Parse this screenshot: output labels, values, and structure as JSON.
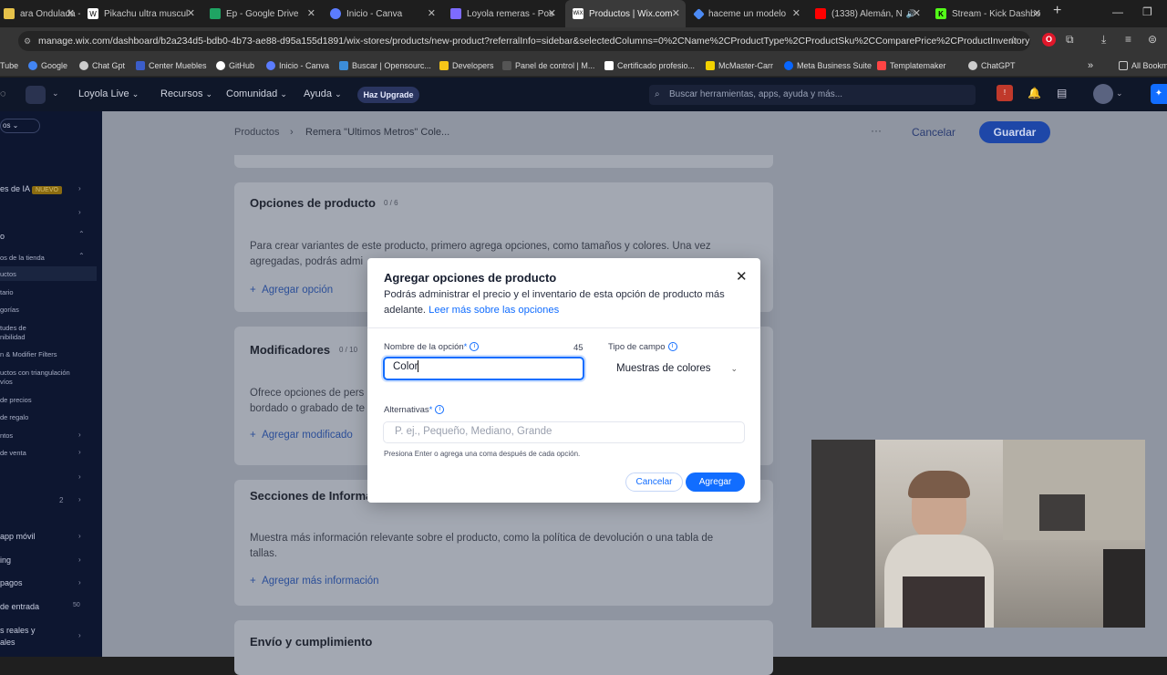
{
  "browser": {
    "tabs": [
      {
        "label": "ara Ondulada -",
        "color": "#e6c24a"
      },
      {
        "label": "Pikachu ultra muscul",
        "color": "#000000",
        "glyph": "W"
      },
      {
        "label": "Ep - Google Drive",
        "color": "#1fa463"
      },
      {
        "label": "Inicio - Canva",
        "color": "#5b7cff"
      },
      {
        "label": "Loyola remeras - Pos",
        "color": "#7d6bff"
      },
      {
        "label": "Productos | Wix.com",
        "color": "#000000",
        "glyph": "WiX"
      },
      {
        "label": "haceme un modelo",
        "color": "#4c8bf5"
      },
      {
        "label": "(1338) Alemán, N",
        "color": "#ff0000"
      },
      {
        "label": "Stream - Kick Dashbo",
        "color": "#53fc18"
      }
    ],
    "url": "manage.wix.com/dashboard/b2a234d5-bdb0-4b73-ae88-d95a155d1891/wix-stores/products/new-product?referralInfo=sidebar&selectedColumns=0%2CName%2CProductType%2CProductSku%2CComparePrice%2CProductInventorySta...",
    "bookmarks": [
      {
        "label": "Tube",
        "color": "#ff0000"
      },
      {
        "label": "Google",
        "color": "#4285f4"
      },
      {
        "label": "Chat Gpt",
        "color": "#cccccc"
      },
      {
        "label": "Center Muebles",
        "color": "#3b5dc9"
      },
      {
        "label": "GitHub",
        "color": "#ffffff"
      },
      {
        "label": "Inicio - Canva",
        "color": "#5b7cff"
      },
      {
        "label": "Buscar | Opensourc...",
        "color": "#3c8dd9"
      },
      {
        "label": "Developers",
        "color": "#f5c518"
      },
      {
        "label": "Panel de control | M...",
        "color": "#555555"
      },
      {
        "label": "Certificado profesio...",
        "color": "#ffffff"
      },
      {
        "label": "McMaster-Carr",
        "color": "#f2d100"
      },
      {
        "label": "Meta Business Suite",
        "color": "#0866ff"
      },
      {
        "label": "Templatemaker",
        "color": "#ff4444"
      },
      {
        "label": "ChatGPT",
        "color": "#cccccc"
      }
    ],
    "all_bookmarks": "All Bookm"
  },
  "wix_nav": {
    "site_name": "Loyola Live",
    "resources": "Recursos",
    "community": "Comunidad",
    "help": "Ayuda",
    "upgrade": "Haz Upgrade",
    "search_placeholder": "Buscar herramientas, apps, ayuda y más..."
  },
  "sidebar": {
    "top_label": "os",
    "items": [
      {
        "label": "es de IA",
        "badge": "NUEVO"
      },
      {
        "label": "o"
      },
      {
        "label": "os de la tienda"
      },
      {
        "label": "uctos"
      },
      {
        "label": "tario"
      },
      {
        "label": "gorías"
      },
      {
        "label": "tudes de"
      },
      {
        "label": "nibilidad"
      },
      {
        "label": "n & Modifier Filters"
      },
      {
        "label": "uctos con triangulación"
      },
      {
        "label": "víos"
      },
      {
        "label": "de precios"
      },
      {
        "label": "de regalo"
      },
      {
        "label": "ntos"
      },
      {
        "label": "de venta"
      },
      {
        "label": "2"
      },
      {
        "label": "app móvil"
      },
      {
        "label": "ing"
      },
      {
        "label": "pagos"
      },
      {
        "label": "de entrada",
        "count": "50"
      },
      {
        "label": "s reales y"
      },
      {
        "label": "ales"
      }
    ]
  },
  "page": {
    "breadcrumb_root": "Productos",
    "breadcrumb_current": "Remera \"Ultimos Metros\" Cole...",
    "cancel": "Cancelar",
    "save": "Guardar",
    "options_card": {
      "title": "Opciones de producto",
      "count": "0 / 6",
      "text": "Para crear variantes de este producto, primero agrega opciones, como tamaños y colores. Una vez agregadas, podrás admi",
      "add": "Agregar opción"
    },
    "modifiers_card": {
      "title": "Modificadores",
      "count": "0 / 10",
      "text": "Ofrece opciones de pers bordado o grabado de te",
      "add": "Agregar modificado"
    },
    "info_card": {
      "title": "Secciones de Informa",
      "text": "Muestra más información relevante sobre el producto, como la política de devolución o una tabla de tallas.",
      "add": "Agregar más información"
    },
    "shipping_card": {
      "title": "Envío y cumplimiento"
    }
  },
  "modal": {
    "title": "Agregar opciones de producto",
    "desc": "Podrás administrar el precio y el inventario de esta opción de producto más adelante.",
    "link": "Leer más sobre las opciones",
    "name_label": "Nombre de la opción",
    "name_counter": "45",
    "name_value": "Color",
    "type_label": "Tipo de campo",
    "type_value": "Muestras de colores",
    "alt_label": "Alternativas",
    "alt_placeholder": "P. ej., Pequeño, Mediano, Grande",
    "hint": "Presiona Enter o agrega una coma después de cada opción.",
    "cancel": "Cancelar",
    "add": "Agregar"
  }
}
